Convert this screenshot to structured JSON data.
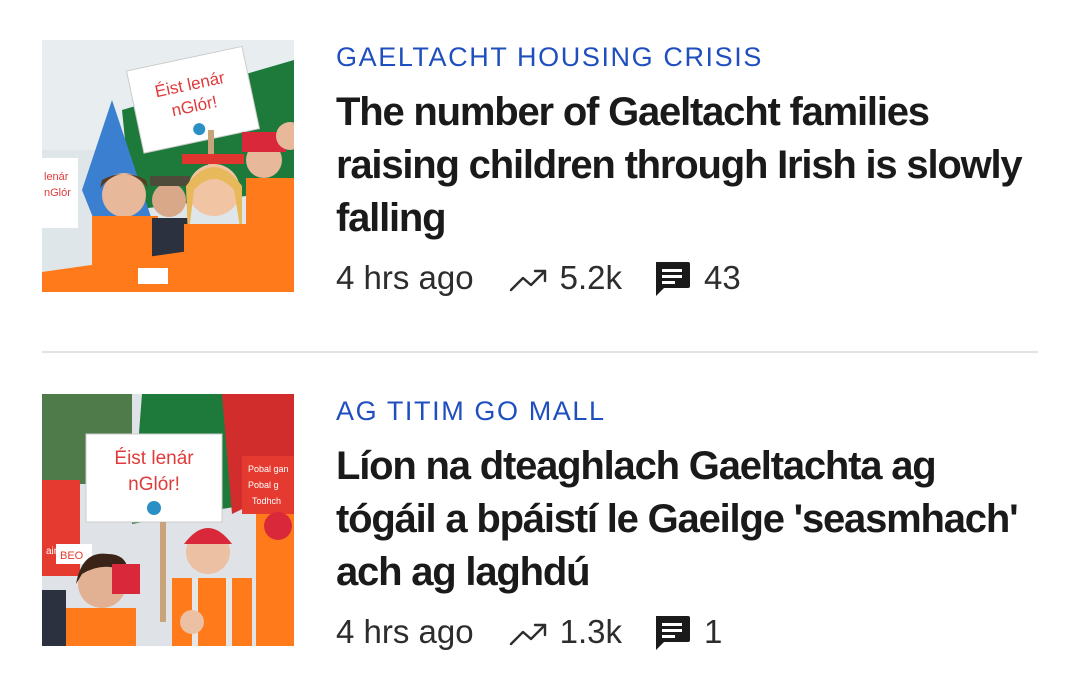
{
  "colors": {
    "accent": "#1f4fbf",
    "headline": "#1a1a1a",
    "meta": "#2d2d2d",
    "divider": "#e2e2e2"
  },
  "articles": [
    {
      "kicker": "GAELTACHT HOUSING CRISIS",
      "headline": "The number of Gaeltacht families raising children through Irish is slowly falling",
      "time": "4 hrs ago",
      "views": "5.2k",
      "comments": "43",
      "thumbnail": {
        "sign_line1": "Éist lenár",
        "sign_line2": "nGlór!",
        "side_sign_line1": "lenár",
        "side_sign_line2": "nGlór"
      }
    },
    {
      "kicker": "AG TITIM GO MALL",
      "headline": "Líon na dteaghlach Gaeltachta ag tógáil a bpáistí le Gaeilge 'seasmhach' ach ag laghdú",
      "time": "4 hrs ago",
      "views": "1.3k",
      "comments": "1",
      "thumbnail": {
        "sign_line1": "Éist lenár",
        "sign_line2": "nGlór!",
        "side_sign_line1": "Pobal gan",
        "side_sign_line2": "Pobal g",
        "side_sign_line3": "Todhch",
        "small_sign": "BEO"
      }
    }
  ],
  "icons": {
    "trend": "trending-up-icon",
    "comment": "comment-bubble-icon"
  }
}
